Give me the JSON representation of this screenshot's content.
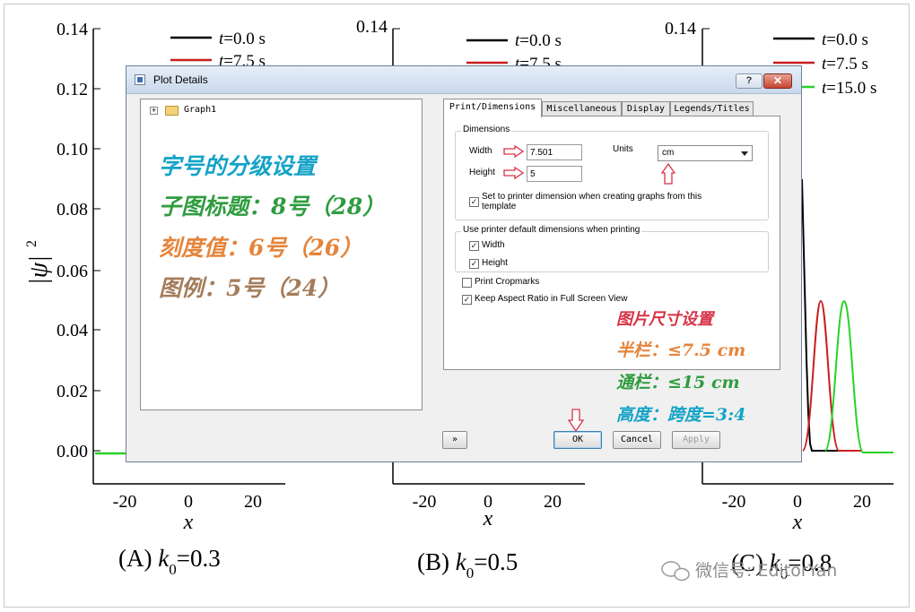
{
  "background": {
    "y_axis_label": "|ψ|",
    "y_axis_exponent": "2",
    "y_ticks": [
      "0.14",
      "0.12",
      "0.10",
      "0.08",
      "0.06",
      "0.04",
      "0.02",
      "0.00"
    ],
    "panel_b_top_tick": "0.14",
    "panel_c_top_tick": "0.14",
    "x_ticks": [
      "-20",
      "0",
      "20"
    ],
    "x_label": "x",
    "legend": [
      {
        "t": "t",
        "value": "=0.0 s",
        "color": "#000000"
      },
      {
        "t": "t",
        "value": "=7.5 s",
        "color": "#c81e1e"
      },
      {
        "t": "t",
        "value": "=15.0 s",
        "color": "#2ad12a"
      }
    ],
    "captions": [
      {
        "prefix": "(A) ",
        "k": "k",
        "sub": "0",
        "value": "=0.3"
      },
      {
        "prefix": "(B) ",
        "k": "k",
        "sub": "0",
        "value": "=0.5"
      },
      {
        "prefix": "(C) ",
        "k": "k",
        "sub": "0",
        "value": "=0.8"
      }
    ],
    "watermark": "微信号: EditorYan"
  },
  "dialog": {
    "title": "Plot Details",
    "help_label": "?",
    "close_label": "✕",
    "tree": {
      "expander": "+",
      "root_label": "Graph1"
    },
    "notes": [
      "字号的分级设置",
      "子图标题：8号（28）",
      "刻度值：6号（26）",
      "图例：5号（24）"
    ],
    "tabs": [
      "Print/Dimensions",
      "Miscellaneous",
      "Display",
      "Legends/Titles"
    ],
    "dimensions": {
      "group_title": "Dimensions",
      "width_label": "Width",
      "width_value": "7.501",
      "height_label": "Height",
      "height_value": "5",
      "units_label": "Units",
      "units_value": "cm",
      "set_printer_label": "Set to printer dimension when creating graphs from this",
      "set_printer_label_2": "template"
    },
    "printer_default": {
      "group_title": "Use printer default dimensions when printing",
      "width_label": "Width",
      "height_label": "Height"
    },
    "print_cropmarks_label": "Print Cropmarks",
    "keep_aspect_label": "Keep Aspect Ratio in Full Screen View",
    "size_notes": [
      "图片尺寸设置",
      "半栏：≤7.5 cm",
      "通栏：≤15 cm",
      "高度：跨度=3:4"
    ],
    "buttons": {
      "more": "»",
      "ok": "OK",
      "cancel": "Cancel",
      "apply": "Apply"
    }
  }
}
